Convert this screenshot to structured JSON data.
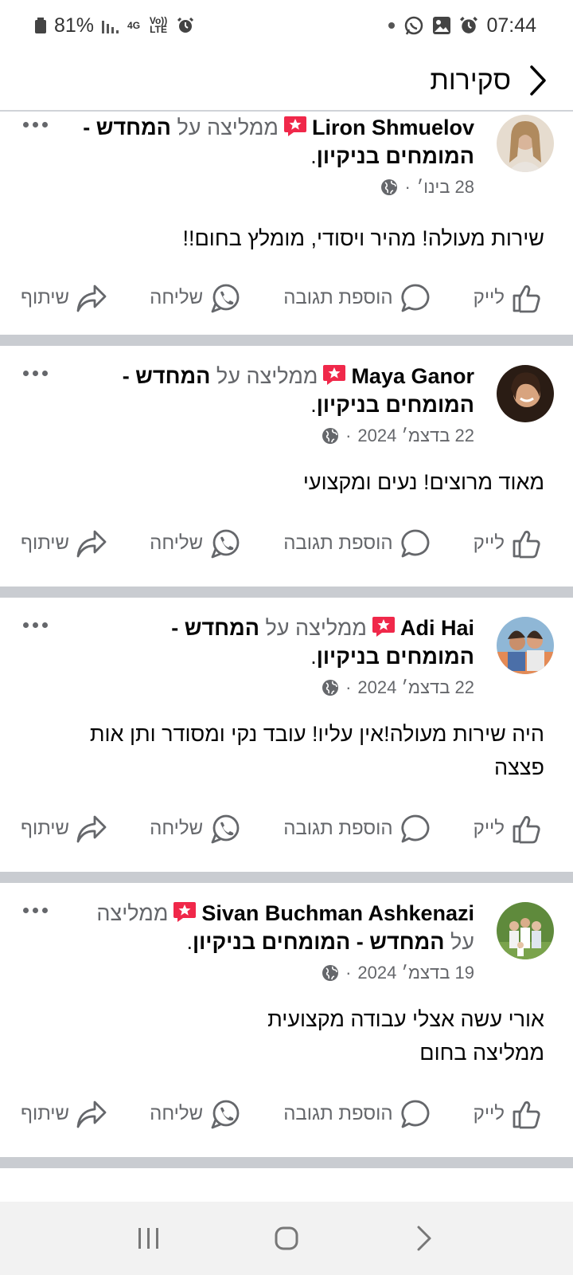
{
  "status_bar": {
    "battery": "81%",
    "network": "4G",
    "volte": "Vo)) LTE",
    "time": "07:44"
  },
  "header": {
    "title": "סקירות"
  },
  "common": {
    "recommends": "ממליצה",
    "on": "על",
    "like": "לייק",
    "comment": "הוספת תגובה",
    "send": "שליחה",
    "share": "שיתוף"
  },
  "reviews": [
    {
      "name": "Liron Shmuelov",
      "page_part1": "המחדש -",
      "page_part2": "המומחים בניקיון",
      "date": "28 בינו׳",
      "text": "שירות מעולה! מהיר ויסודי, מומלץ בחום!!"
    },
    {
      "name": "Maya Ganor",
      "page_part1": "המחדש -",
      "page_part2": "המומחים בניקיון",
      "date": "22 בדצמ׳ 2024",
      "text": "מאוד מרוצים! נעים ומקצועי"
    },
    {
      "name": "Adi Hai",
      "page_part1": "המחדש -",
      "page_part2": "המומחים בניקיון",
      "date": "22 בדצמ׳ 2024",
      "text": "היה שירות מעולה!אין עליו! עובד נקי ומסודר ותן אות\nפצצה"
    },
    {
      "name": "Sivan Buchman Ashkenazi",
      "page_part1": "המחדש - המומחים בניקיון",
      "page_part2": "",
      "date": "19 בדצמ׳ 2024",
      "text": "אורי עשה אצלי עבודה מקצועית\nממליצה בחום"
    }
  ],
  "colors": {
    "accent_red": "#f0284a",
    "secondary_text": "#65676b",
    "divider": "#c9ccd1"
  }
}
